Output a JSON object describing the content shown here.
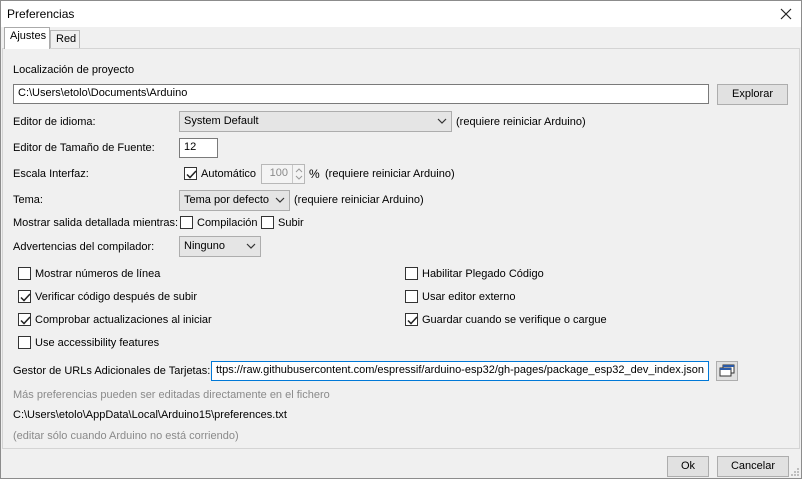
{
  "window": {
    "title": "Preferencias"
  },
  "tabs": [
    {
      "label": "Ajustes",
      "active": true
    },
    {
      "label": "Red",
      "active": false
    }
  ],
  "project": {
    "label": "Localización de proyecto",
    "path": "C:\\Users\\etolo\\Documents\\Arduino",
    "browse_label": "Explorar"
  },
  "language": {
    "label": "Editor de idioma:",
    "value": "System Default",
    "note": "(requiere reiniciar Arduino)"
  },
  "font_size": {
    "label": "Editor de Tamaño de Fuente:",
    "value": "12"
  },
  "scale": {
    "label": "Escala Interfaz:",
    "auto_label": "Automático",
    "auto_checked": true,
    "value": "100",
    "unit": "%",
    "note": "(requiere reiniciar Arduino)"
  },
  "theme": {
    "label": "Tema:",
    "value": "Tema por defecto",
    "note": "(requiere reiniciar Arduino)"
  },
  "verbose": {
    "label": "Mostrar salida detallada mientras:",
    "compile_label": "Compilación",
    "compile_checked": false,
    "upload_label": "Subir",
    "upload_checked": false
  },
  "warnings": {
    "label": "Advertencias del compilador:",
    "value": "Ninguno"
  },
  "options_left": [
    {
      "label": "Mostrar números de línea",
      "checked": false
    },
    {
      "label": "Verificar código después de subir",
      "checked": true
    },
    {
      "label": "Comprobar actualizaciones al iniciar",
      "checked": true
    },
    {
      "label": "Use accessibility features",
      "checked": false
    }
  ],
  "options_right": [
    {
      "label": "Habilitar Plegado Código",
      "checked": false
    },
    {
      "label": "Usar editor externo",
      "checked": false
    },
    {
      "label": "Guardar cuando se verifique o cargue",
      "checked": true
    }
  ],
  "board_urls": {
    "label": "Gestor de URLs Adicionales de Tarjetas:",
    "value": "ttps://raw.githubusercontent.com/espressif/arduino-esp32/gh-pages/package_esp32_dev_index.json"
  },
  "footer": {
    "more_prefs": "Más preferencias pueden ser editadas directamente en el fichero",
    "prefs_path": "C:\\Users\\etolo\\AppData\\Local\\Arduino15\\preferences.txt",
    "edit_note": "(editar sólo cuando Arduino no está corriendo)"
  },
  "buttons": {
    "ok": "Ok",
    "cancel": "Cancelar"
  }
}
